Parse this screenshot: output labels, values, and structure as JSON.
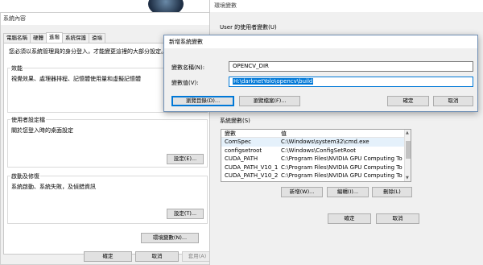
{
  "system_properties": {
    "title": "系統內容",
    "tabs": [
      "電腦名稱",
      "硬體",
      "進階",
      "系統保護",
      "遠端"
    ],
    "active_tab": "進階",
    "admin_note": "您必須以系統管理員的身分登入，才能變更這裡的大部分設定。",
    "performance": {
      "title": "效能",
      "desc": "視覺效果、處理器排程、記憶體使用量和虛擬記憶體"
    },
    "user_profiles": {
      "title": "使用者設定檔",
      "desc": "關於您登入時的桌面設定",
      "settings_button": "設定(E)..."
    },
    "startup": {
      "title": "啟動及修復",
      "desc": "系統啟動、系統失敗，及偵錯資訊",
      "settings_button": "設定(T)..."
    },
    "env_vars_button": "環境變數(N)...",
    "ok_button": "確定",
    "cancel_button": "取消",
    "apply_button": "套用(A)"
  },
  "env_window": {
    "title": "環境變數",
    "user_section_label": "User 的使用者變數(U)",
    "system_section_label": "系統變數(S)",
    "columns": {
      "variable": "變數",
      "value": "值"
    },
    "rows": [
      {
        "variable": "ComSpec",
        "value": "C:\\Windows\\system32\\cmd.exe"
      },
      {
        "variable": "configsetroot",
        "value": "C:\\Windows\\ConfigSetRoot"
      },
      {
        "variable": "CUDA_PATH",
        "value": "C:\\Program Files\\NVIDIA GPU Computing To..."
      },
      {
        "variable": "CUDA_PATH_V10_1",
        "value": "C:\\Program Files\\NVIDIA GPU Computing To..."
      },
      {
        "variable": "CUDA_PATH_V10_2",
        "value": "C:\\Program Files\\NVIDIA GPU Computing To..."
      }
    ],
    "new_button": "新增(W)...",
    "edit_button": "編輯(I)...",
    "delete_button": "刪除(L)",
    "ok_button": "確定",
    "cancel_button": "取消"
  },
  "new_var_dialog": {
    "title": "新增系統變數",
    "name_label": "變數名稱(N):",
    "name_value": "OPENCV_DIR",
    "value_label": "變數值(V):",
    "value_value": "H:\\darknetYolo\\opencv\\build",
    "browse_dir_button": "瀏覽目錄(D)...",
    "browse_file_button": "瀏覽檔案(F)...",
    "ok_button": "確定",
    "cancel_button": "取消"
  },
  "colors": {
    "accent": "#0078d7",
    "selection_bg": "#0078d7",
    "dialog_bg": "#f0f0f0"
  }
}
